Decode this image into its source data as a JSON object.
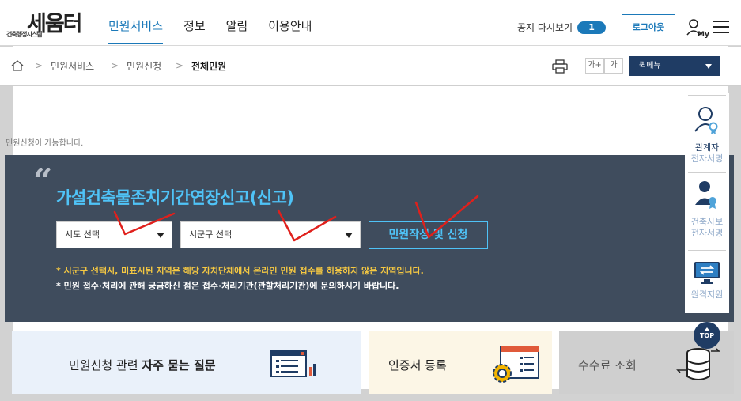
{
  "header": {
    "logo_text": "세움터",
    "logo_sub": "건축행정시스템",
    "nav": [
      {
        "label": "민원서비스",
        "active": true
      },
      {
        "label": "정보",
        "active": false
      },
      {
        "label": "알림",
        "active": false
      },
      {
        "label": "이용안내",
        "active": false
      }
    ],
    "notice_toggle_label": "공지 다시보기",
    "notice_count": "1",
    "login_label": "로그아웃",
    "my_label": "My"
  },
  "breadcrumb": {
    "items": [
      "민원서비스",
      "민원신청",
      "전체민원"
    ]
  },
  "tools": {
    "font_up": "가+",
    "font_down": "가",
    "quickmenu_label": "퀵메뉴"
  },
  "status_text": "민원신청이 가능합니다.",
  "panel": {
    "quote": "“",
    "title": "가설건축물존치기간연장신고(신고)",
    "sido_select": "시도 선택",
    "sigungu_select": "시군구 선택",
    "apply_button": "민원작성 및 신청",
    "note_yellow": "* 시군구 선택시, 미표시된 지역은 해당 자치단체에서 온라인 민원 접수를 허용하지 않은 지역입니다.",
    "note_white": "* 민원 접수·처리에 관해 궁금하신 점은 접수·처리기관(관할처리기관)에 문의하시기 바랍니다."
  },
  "side": {
    "items": [
      {
        "line1": "관계자",
        "line2": "전자서명"
      },
      {
        "line1": "건축사보",
        "line2": "전자서명"
      },
      {
        "line1": "원격지원",
        "line2": ""
      }
    ],
    "top_label": "TOP"
  },
  "cards": {
    "faq_prefix": "민원신청 관련 ",
    "faq_bold": "자주 묻는 질문",
    "cert_label": "인증서 등록",
    "fee_label": "수수료 조회"
  },
  "colors": {
    "accent_blue": "#1b79b9",
    "panel_bg": "#3f4c5d",
    "title_cyan": "#4fc3f7",
    "note_yellow": "#f5c842",
    "navy": "#1f3c64",
    "scribble_red": "#e0201c"
  }
}
